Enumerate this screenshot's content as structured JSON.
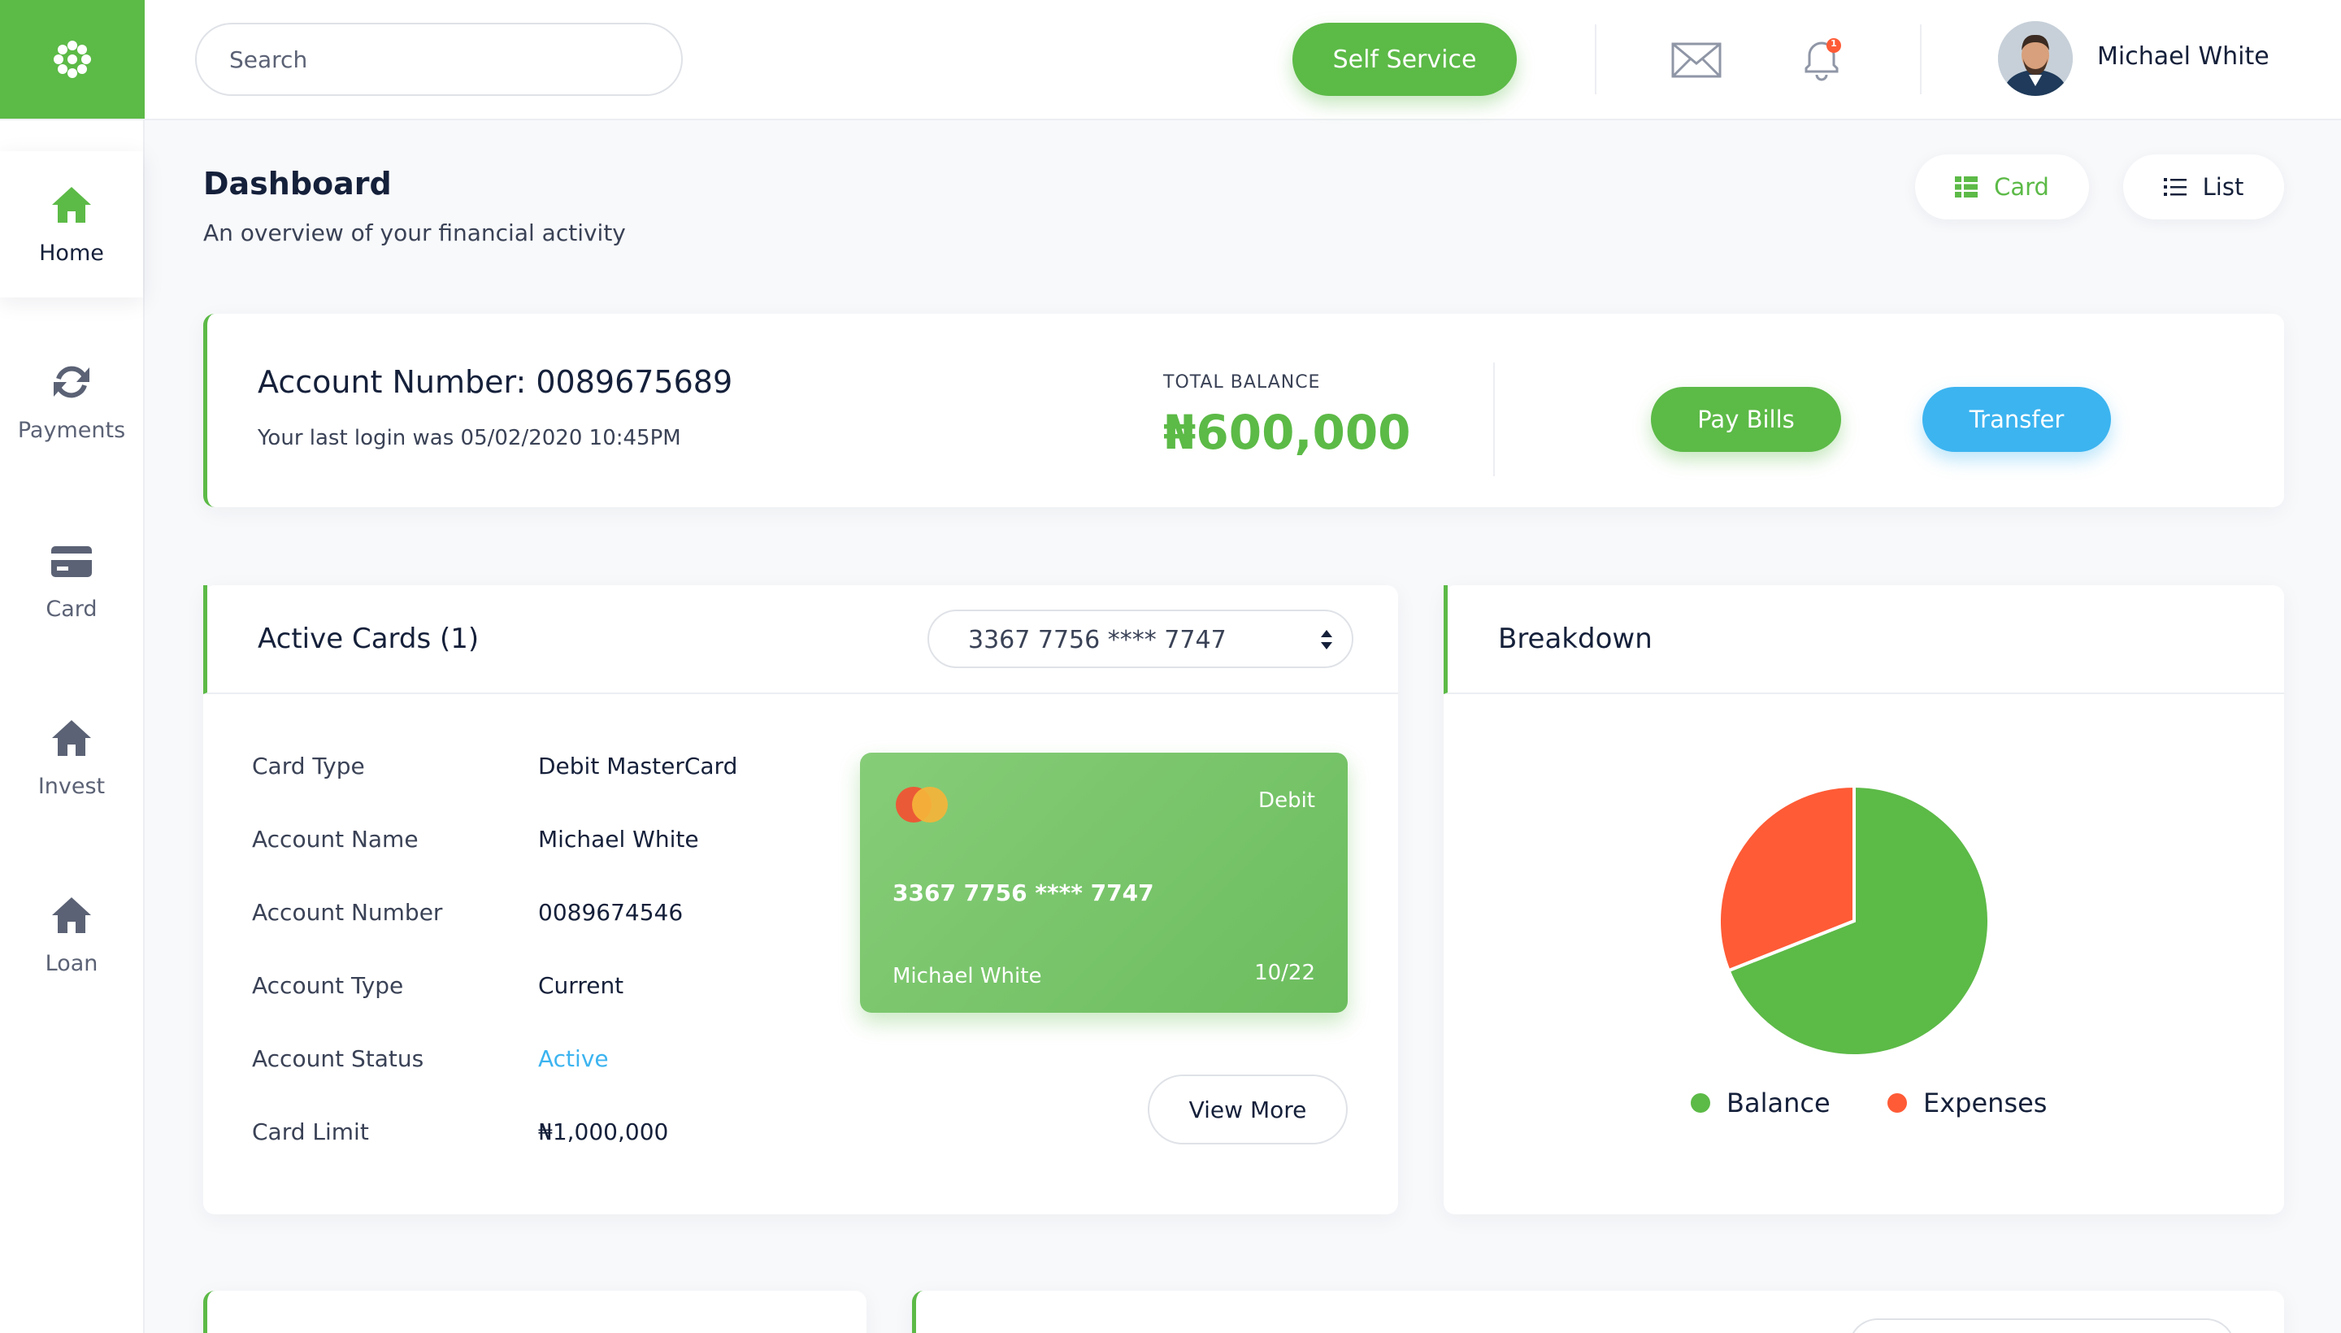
{
  "colors": {
    "brand": "#5cba47",
    "accent_blue": "#3cb4f0",
    "expenses": "#fe5b36",
    "text": "#15203a"
  },
  "header": {
    "search_placeholder": "Search",
    "self_service_label": "Self Service",
    "notification_count": "1",
    "user_name": "Michael White"
  },
  "sidebar": {
    "items": [
      {
        "label": "Home",
        "icon": "home-icon",
        "active": true
      },
      {
        "label": "Payments",
        "icon": "refresh-icon",
        "active": false
      },
      {
        "label": "Card",
        "icon": "credit-card-icon",
        "active": false
      },
      {
        "label": "Invest",
        "icon": "home-icon",
        "active": false
      },
      {
        "label": "Loan",
        "icon": "home-icon",
        "active": false
      }
    ]
  },
  "page": {
    "title": "Dashboard",
    "subtitle": "An overview of your financial activity",
    "view_toggle": {
      "card_label": "Card",
      "list_label": "List",
      "selected": "Card"
    }
  },
  "account": {
    "number_label": "Account Number: 0089675689",
    "last_login": "Your last login was 05/02/2020 10:45PM",
    "total_balance_label": "TOTAL BALANCE",
    "total_balance_value": "₦600,000",
    "pay_bills_label": "Pay Bills",
    "transfer_label": "Transfer"
  },
  "active_cards": {
    "title": "Active Cards (1)",
    "selected_card": "3367 7756 **** 7747",
    "details": [
      {
        "label": "Card Type",
        "value": "Debit MasterCard"
      },
      {
        "label": "Account Name",
        "value": "Michael White"
      },
      {
        "label": "Account Number",
        "value": "0089674546"
      },
      {
        "label": "Account Type",
        "value": "Current"
      },
      {
        "label": "Account Status",
        "value": "Active"
      },
      {
        "label": "Card Limit",
        "value": "₦1,000,000"
      }
    ],
    "card_visual": {
      "type": "Debit",
      "number": "3367 7756 **** 7747",
      "holder": "Michael White",
      "expiry": "10/22"
    },
    "view_more_label": "View More"
  },
  "breakdown": {
    "title": "Breakdown",
    "legend": [
      {
        "label": "Balance",
        "color": "#5cba47"
      },
      {
        "label": "Expenses",
        "color": "#fe5b36"
      }
    ]
  },
  "chart_data": {
    "type": "pie",
    "categories": [
      "Balance",
      "Expenses"
    ],
    "values": [
      69,
      31
    ]
  }
}
